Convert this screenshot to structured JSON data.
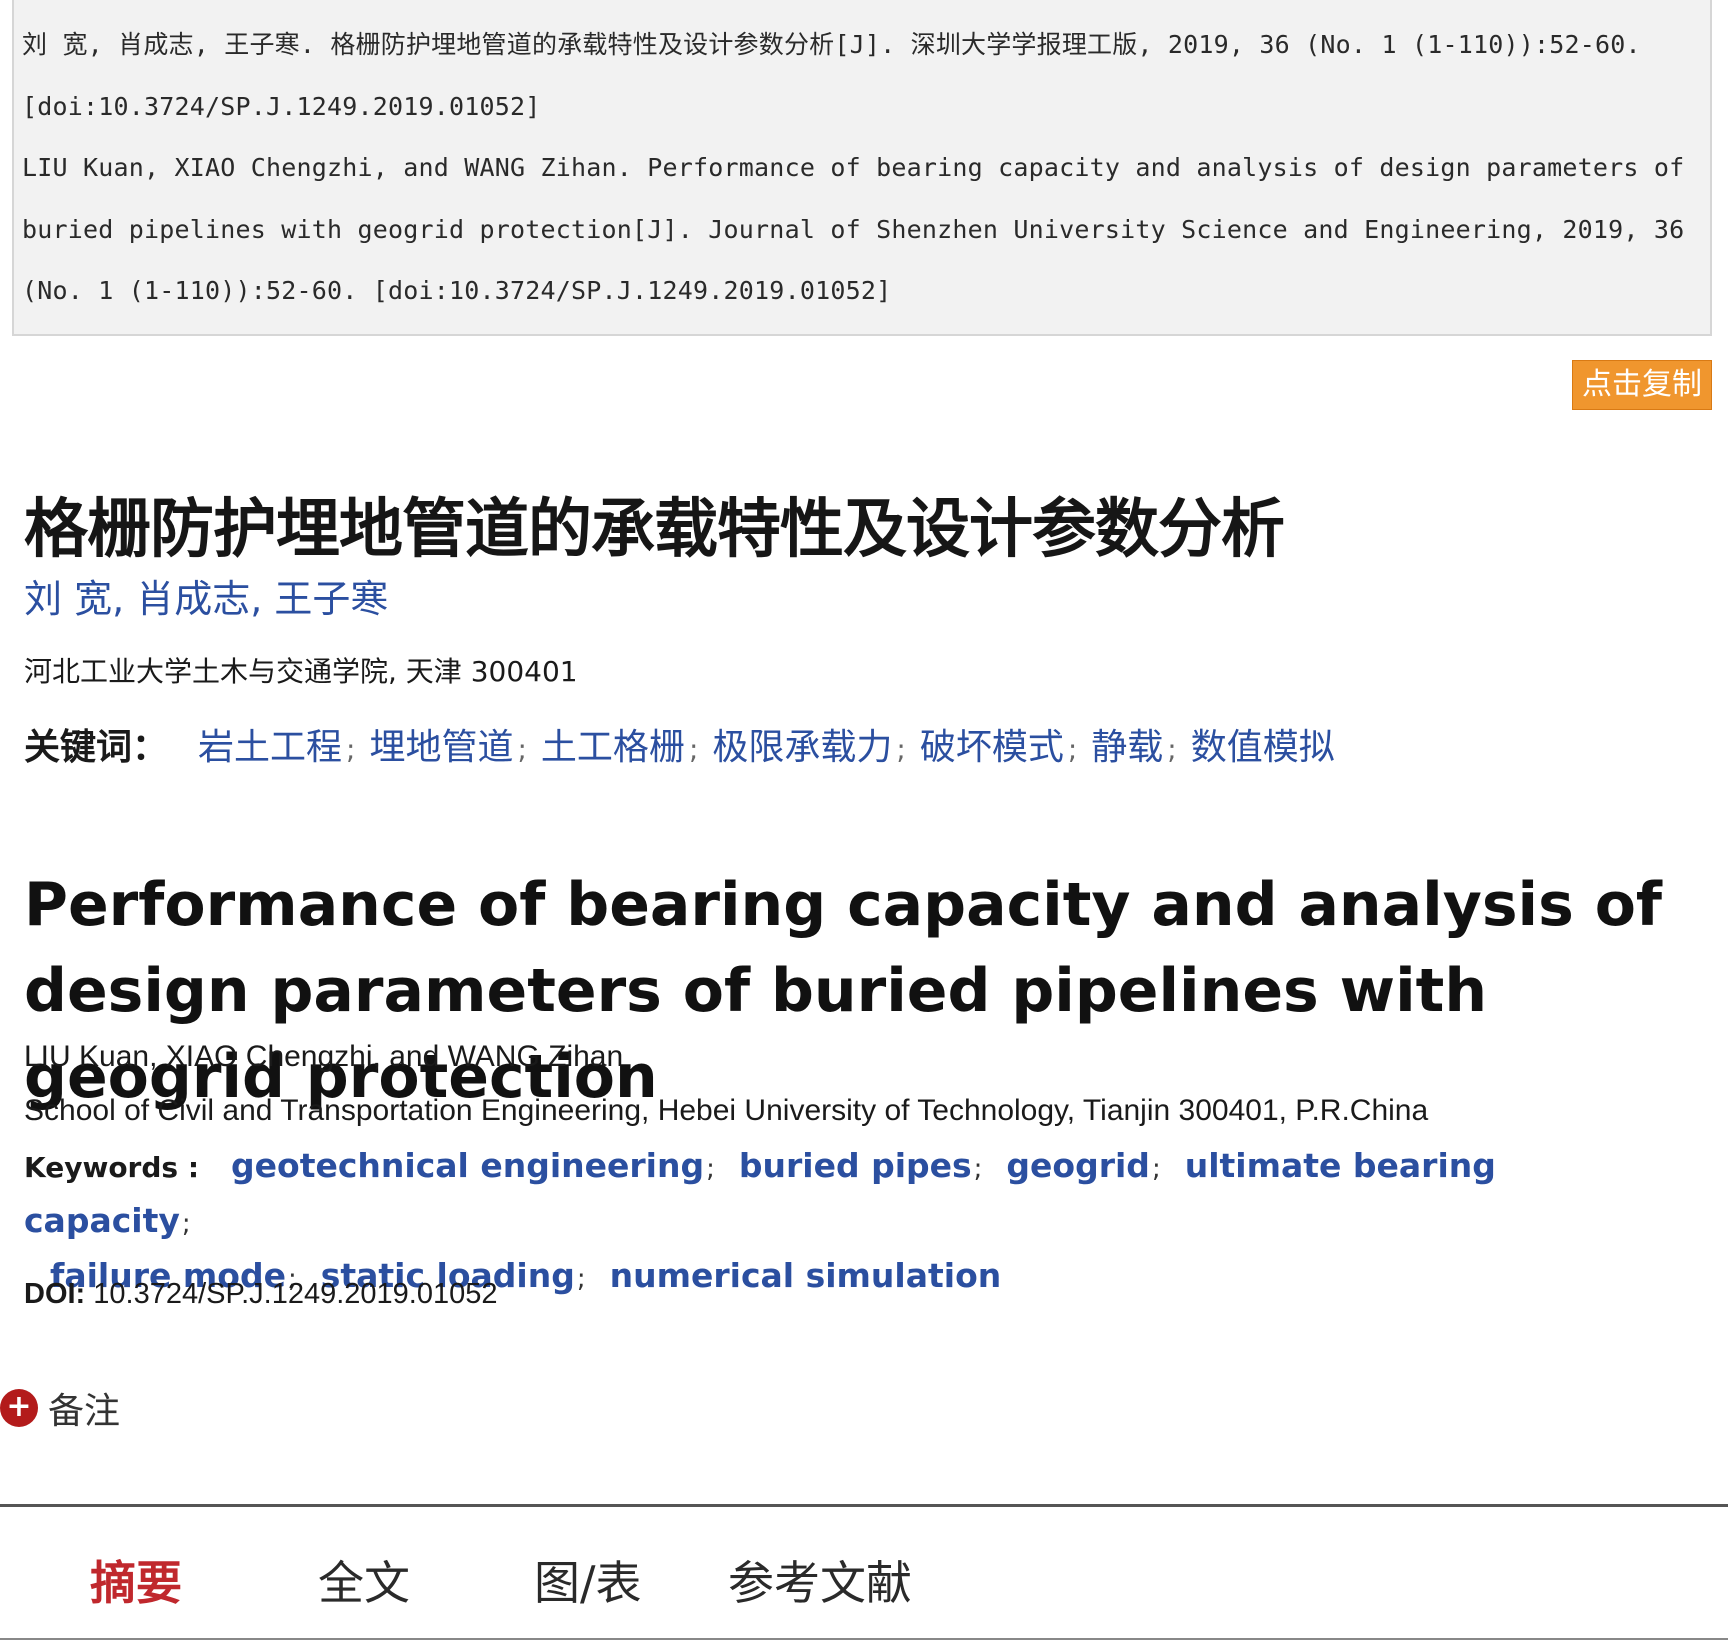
{
  "citation": {
    "cn": "刘 宽, 肖成志, 王子寒. 格栅防护埋地管道的承载特性及设计参数分析[J]. 深圳大学学报理工版, 2019, 36 (No. 1 (1-110)):52-60. [doi:10.3724/SP.J.1249.2019.01052]",
    "en": "LIU Kuan, XIAO Chengzhi, and WANG Zihan. Performance of bearing capacity and analysis of design parameters of buried pipelines with geogrid protection[J]. Journal of Shenzhen University Science and Engineering, 2019, 36 (No. 1 (1-110)):52-60. [doi:10.3724/SP.J.1249.2019.01052]"
  },
  "copy_button": {
    "label": "点击复制",
    "color": "#f0962e"
  },
  "article_cn": {
    "title": "格栅防护埋地管道的承载特性及设计参数分析",
    "authors": "刘 宽, 肖成志, 王子寒",
    "affiliation": "河北工业大学土木与交通学院, 天津 300401",
    "keywords_label": "关键词：",
    "keywords": [
      "岩土工程",
      "埋地管道",
      "土工格栅",
      "极限承载力",
      "破坏模式",
      "静载",
      "数值模拟"
    ]
  },
  "article_en": {
    "title": "Performance of bearing capacity and analysis of design parameters of buried pipelines with geogrid protection",
    "authors": "LIU Kuan, XIAO Chengzhi, and WANG Zihan",
    "affiliation": "School of Civil and Transportation Engineering, Hebei University of Technology, Tianjin 300401, P.R.China",
    "keywords_label": "Keywords :",
    "keywords": [
      "geotechnical engineering",
      "buried pipes",
      "geogrid",
      "ultimate bearing capacity",
      "failure mode",
      "static loading",
      "numerical simulation"
    ]
  },
  "doi": {
    "label": "DOI:",
    "value": "10.3724/SP.J.1249.2019.01052"
  },
  "notes": {
    "icon": "plus-circle-icon",
    "label": "备注",
    "icon_color": "#b31b1b"
  },
  "tabs": [
    {
      "label": "摘要",
      "active": true
    },
    {
      "label": "全文",
      "active": false
    },
    {
      "label": "图/表",
      "active": false
    },
    {
      "label": "参考文献",
      "active": false
    }
  ],
  "colors": {
    "link": "#2b4fa0",
    "active_tab": "#c0282d"
  }
}
